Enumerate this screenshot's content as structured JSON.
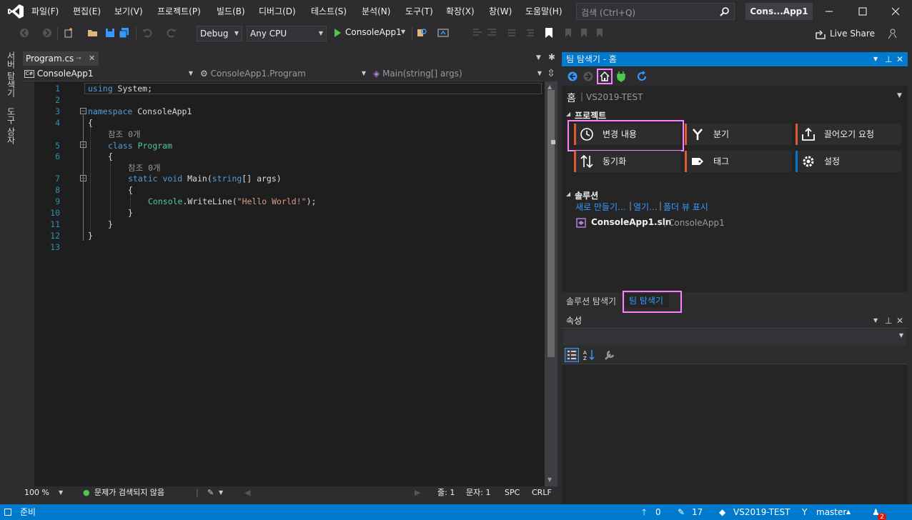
{
  "menu": {
    "items": [
      "파일(F)",
      "편집(E)",
      "보기(V)",
      "프로젝트(P)",
      "빌드(B)",
      "디버그(D)",
      "테스트(S)",
      "분석(N)",
      "도구(T)",
      "확장(X)",
      "창(W)",
      "도움말(H)"
    ],
    "search_placeholder": "검색 (Ctrl+Q)",
    "window_title": "Cons...App1"
  },
  "toolbar": {
    "config": "Debug",
    "platform": "Any CPU",
    "run_target": "ConsoleApp1",
    "live_share": "Live Share"
  },
  "left_strip": {
    "server_explorer": "서버 탐색기",
    "toolbox": "도구 상자"
  },
  "editor": {
    "tab": "Program.cs",
    "nav_project": "ConsoleApp1",
    "nav_class": "ConsoleApp1.Program",
    "nav_member": "Main(string[] args)",
    "line_numbers": [
      "1",
      "2",
      "3",
      "4",
      "5",
      "6",
      "7",
      "8",
      "9",
      "10",
      "11",
      "12",
      "13"
    ],
    "ref_count_label": "참조 0개",
    "code": {
      "l1_kw": "using",
      "l1_rest": " System;",
      "l3_kw": "namespace",
      "l3_rest": " ConsoleApp1",
      "brace_open": "{",
      "brace_close": "}",
      "l5_kw": "class",
      "l5_type": "Program",
      "l7_kw1": "static",
      "l7_kw2": "void",
      "l7_name": "Main(",
      "l7_kw3": "string",
      "l7_rest": "[] args)",
      "l9_type": "Console",
      "l9_call": ".WriteLine(",
      "l9_str": "\"Hello World!\"",
      "l9_end": ");"
    },
    "zoom": "100 %",
    "issues": "문제가 검색되지 않음",
    "line": "줄: 1",
    "col": "문자: 1",
    "spc": "SPC",
    "crlf": "CRLF"
  },
  "team_explorer": {
    "title": "팀 탐색기 - 홈",
    "home_label": "홈",
    "server": "VS2019-TEST",
    "projects_header": "프로젝트",
    "tiles": [
      {
        "label": "변경 내용",
        "color": "#e05a2b"
      },
      {
        "label": "분기",
        "color": "#e05a2b"
      },
      {
        "label": "끌어오기 요청",
        "color": "#e05a2b"
      },
      {
        "label": "동기화",
        "color": "#e05a2b"
      },
      {
        "label": "태그",
        "color": "#e05a2b"
      },
      {
        "label": "설정",
        "color": "#007acc"
      }
    ],
    "solutions_header": "솔루션",
    "link_new": "새로 만들기...",
    "link_open": "열기...",
    "link_folder": "폴더 뷰 표시",
    "sln_name": "ConsoleApp1.sln",
    "sln_project": "ConsoleApp1",
    "tab_solution_explorer": "솔루션 탐색기",
    "tab_team_explorer": "팀 탐색기"
  },
  "properties": {
    "title": "속성"
  },
  "statusbar": {
    "ready": "준비",
    "up_count": "0",
    "pencil_count": "17",
    "repo": "VS2019-TEST",
    "branch": "master",
    "notifications": "2"
  },
  "colors": {
    "accent": "#007acc",
    "highlight": "#ff80ff"
  }
}
